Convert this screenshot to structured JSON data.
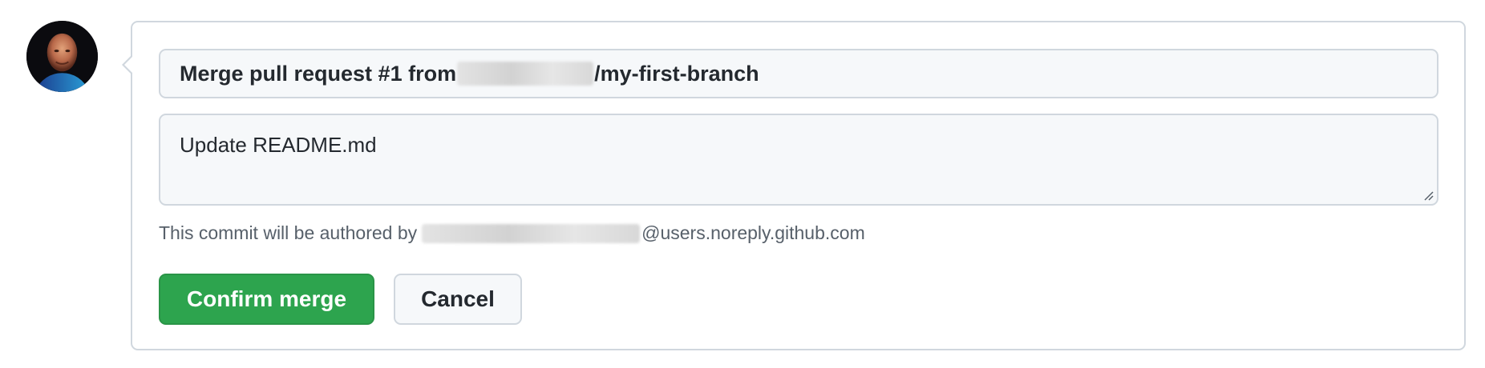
{
  "author": {
    "avatar_icon": "user-avatar-photo"
  },
  "merge_form": {
    "commit_title_prefix": "Merge pull request #1 from",
    "commit_title_suffix": "/my-first-branch",
    "commit_body": "Update README.md",
    "author_note_prefix": "This commit will be authored by",
    "author_note_suffix": "@users.noreply.github.com"
  },
  "actions": {
    "confirm_label": "Confirm merge",
    "cancel_label": "Cancel"
  },
  "colors": {
    "confirm_button": "#2da44e",
    "border": "#d0d7de",
    "field_background": "#f6f8fa",
    "muted_text": "#57606a"
  }
}
